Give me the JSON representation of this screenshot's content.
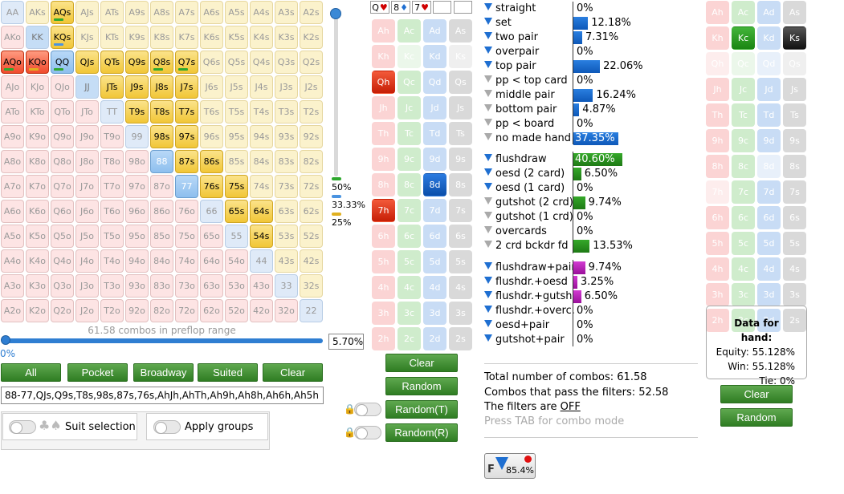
{
  "range_grid": {
    "rows": [
      [
        "AA",
        "AKs",
        "AQs",
        "AJs",
        "ATs",
        "A9s",
        "A8s",
        "A7s",
        "A6s",
        "A5s",
        "A4s",
        "A3s",
        "A2s"
      ],
      [
        "AKo",
        "KK",
        "KQs",
        "KJs",
        "KTs",
        "K9s",
        "K8s",
        "K7s",
        "K6s",
        "K5s",
        "K4s",
        "K3s",
        "K2s"
      ],
      [
        "AQo",
        "KQo",
        "QQ",
        "QJs",
        "QTs",
        "Q9s",
        "Q8s",
        "Q7s",
        "Q6s",
        "Q5s",
        "Q4s",
        "Q3s",
        "Q2s"
      ],
      [
        "AJo",
        "KJo",
        "QJo",
        "JJ",
        "JTs",
        "J9s",
        "J8s",
        "J7s",
        "J6s",
        "J5s",
        "J4s",
        "J3s",
        "J2s"
      ],
      [
        "ATo",
        "KTo",
        "QTo",
        "JTo",
        "TT",
        "T9s",
        "T8s",
        "T7s",
        "T6s",
        "T5s",
        "T4s",
        "T3s",
        "T2s"
      ],
      [
        "A9o",
        "K9o",
        "Q9o",
        "J9o",
        "T9o",
        "99",
        "98s",
        "97s",
        "96s",
        "95s",
        "94s",
        "93s",
        "92s"
      ],
      [
        "A8o",
        "K8o",
        "Q8o",
        "J8o",
        "T8o",
        "98o",
        "88",
        "87s",
        "86s",
        "85s",
        "84s",
        "83s",
        "82s"
      ],
      [
        "A7o",
        "K7o",
        "Q7o",
        "J7o",
        "T7o",
        "97o",
        "87o",
        "77",
        "76s",
        "75s",
        "74s",
        "73s",
        "72s"
      ],
      [
        "A6o",
        "K6o",
        "Q6o",
        "J6o",
        "T6o",
        "96o",
        "86o",
        "76o",
        "66",
        "65s",
        "64s",
        "63s",
        "62s"
      ],
      [
        "A5o",
        "K5o",
        "Q5o",
        "J5o",
        "T5o",
        "95o",
        "85o",
        "75o",
        "65o",
        "55",
        "54s",
        "53s",
        "52s"
      ],
      [
        "A4o",
        "K4o",
        "Q4o",
        "J4o",
        "T4o",
        "94o",
        "84o",
        "74o",
        "64o",
        "54o",
        "44",
        "43s",
        "42s"
      ],
      [
        "A3o",
        "K3o",
        "Q3o",
        "J3o",
        "T3o",
        "93o",
        "83o",
        "73o",
        "63o",
        "53o",
        "43o",
        "33",
        "32s"
      ],
      [
        "A2o",
        "K2o",
        "Q2o",
        "J2o",
        "T2o",
        "92o",
        "82o",
        "72o",
        "62o",
        "52o",
        "42o",
        "32o",
        "22"
      ]
    ],
    "selected": [
      "AQs",
      "KQs",
      "QQ",
      "QJs",
      "QTs",
      "Q9s",
      "Q8s",
      "Q7s",
      "JTs",
      "J9s",
      "J8s",
      "J7s",
      "T9s",
      "T8s",
      "T7s",
      "98s",
      "97s",
      "87s",
      "86s",
      "76s",
      "75s",
      "65s",
      "64s",
      "54s",
      "AQo",
      "KQo",
      "88",
      "77"
    ],
    "blue_cells": [
      "88",
      "77"
    ],
    "caption": "61.58 combos in preflop range",
    "pct": "5.70%",
    "slider_min": "0%"
  },
  "legend": [
    "50%",
    "33.33%",
    "25%"
  ],
  "range_buttons": [
    "All",
    "Pocket",
    "Broadway",
    "Suited",
    "Clear"
  ],
  "range_text": "88-77,QJs,Q9s,T8s,98s,87s,76s,AhJh,AhTh,Ah9h,Ah8h,Ah6h,Ah5h",
  "toggles": {
    "suit_selection": "Suit selection",
    "apply_groups": "Apply groups"
  },
  "board_slots": [
    {
      "rank": "Q",
      "suit": "♥",
      "color": "#d00000"
    },
    {
      "rank": "8",
      "suit": "♦",
      "color": "#1f6fd1"
    },
    {
      "rank": "7",
      "suit": "♥",
      "color": "#d00000"
    },
    {
      "rank": "",
      "suit": "",
      "color": "#000"
    },
    {
      "rank": "",
      "suit": "",
      "color": "#000"
    }
  ],
  "card_grid_1": {
    "ranks": [
      "A",
      "K",
      "Q",
      "J",
      "T",
      "9",
      "8",
      "7",
      "6",
      "5",
      "4",
      "3",
      "2"
    ],
    "suits": [
      "h",
      "c",
      "d",
      "s"
    ],
    "selected": [
      "Qh",
      "8d",
      "7h"
    ],
    "dim": [
      "Kc",
      "Ks"
    ]
  },
  "card_grid_2": {
    "ranks": [
      "A",
      "K",
      "Q",
      "J",
      "T",
      "9",
      "8",
      "7",
      "6",
      "5",
      "4",
      "3",
      "2"
    ],
    "suits": [
      "h",
      "c",
      "d",
      "s"
    ],
    "selected": [
      "Kc",
      "Ks"
    ],
    "dim": [
      "Qh",
      "Qc",
      "Qd",
      "Qs",
      "8d",
      "7h"
    ]
  },
  "board_buttons": [
    "Clear",
    "Random",
    "Random(T)",
    "Random(R)"
  ],
  "stats_made": [
    {
      "label": "straight",
      "pct": "0%",
      "val": 0,
      "filter": true
    },
    {
      "label": "set",
      "pct": "12.18%",
      "val": 12.18,
      "filter": true
    },
    {
      "label": "two pair",
      "pct": "7.31%",
      "val": 7.31,
      "filter": true
    },
    {
      "label": "overpair",
      "pct": "0%",
      "val": 0,
      "filter": true
    },
    {
      "label": "top pair",
      "pct": "22.06%",
      "val": 22.06,
      "filter": true
    },
    {
      "label": "pp < top card",
      "pct": "0%",
      "val": 0,
      "filter": false
    },
    {
      "label": "middle pair",
      "pct": "16.24%",
      "val": 16.24,
      "filter": false
    },
    {
      "label": "bottom pair",
      "pct": "4.87%",
      "val": 4.87,
      "filter": false
    },
    {
      "label": "pp < board",
      "pct": "0%",
      "val": 0,
      "filter": false
    },
    {
      "label": "no made hand",
      "pct": "37.35%",
      "val": 37.35,
      "filter": false
    }
  ],
  "stats_draw": [
    {
      "label": "flushdraw",
      "pct": "40.60%",
      "val": 40.6,
      "filter": true
    },
    {
      "label": "oesd (2 card)",
      "pct": "6.50%",
      "val": 6.5,
      "filter": true
    },
    {
      "label": "oesd (1 card)",
      "pct": "0%",
      "val": 0,
      "filter": true
    },
    {
      "label": "gutshot (2 crd)",
      "pct": "9.74%",
      "val": 9.74,
      "filter": false
    },
    {
      "label": "gutshot (1 crd)",
      "pct": "0%",
      "val": 0,
      "filter": false
    },
    {
      "label": "overcards",
      "pct": "0%",
      "val": 0,
      "filter": false
    },
    {
      "label": "2 crd bckdr fd",
      "pct": "13.53%",
      "val": 13.53,
      "filter": false
    }
  ],
  "stats_combo": [
    {
      "label": "flushdraw+pair",
      "pct": "9.74%",
      "val": 9.74,
      "filter": true
    },
    {
      "label": "flushdr.+oesd",
      "pct": "3.25%",
      "val": 3.25,
      "filter": true
    },
    {
      "label": "flushdr.+gutsh.",
      "pct": "6.50%",
      "val": 6.5,
      "filter": true
    },
    {
      "label": "flushdr.+overc.",
      "pct": "0%",
      "val": 0,
      "filter": true
    },
    {
      "label": "oesd+pair",
      "pct": "0%",
      "val": 0,
      "filter": true
    },
    {
      "label": "gutshot+pair",
      "pct": "0%",
      "val": 0,
      "filter": true
    }
  ],
  "summary": {
    "total": "Total number of combos: 61.58",
    "pass": "Combos that pass the filters: 52.58",
    "filters_prefix": "The filters are ",
    "filters_state": "OFF",
    "hint": "Press TAB for combo mode"
  },
  "filter_button_pct": "85.4%",
  "hand_data": {
    "title": "Data for hand:",
    "equity": "Equity: 55.128%",
    "win": "Win: 55.128%",
    "tie": "Tie: 0%"
  },
  "right_buttons": [
    "Clear",
    "Random"
  ],
  "colors": {
    "blue": "#1f6fd1",
    "green": "#2f8f22",
    "magenta": "#cc22cc",
    "red": "#d00000"
  }
}
